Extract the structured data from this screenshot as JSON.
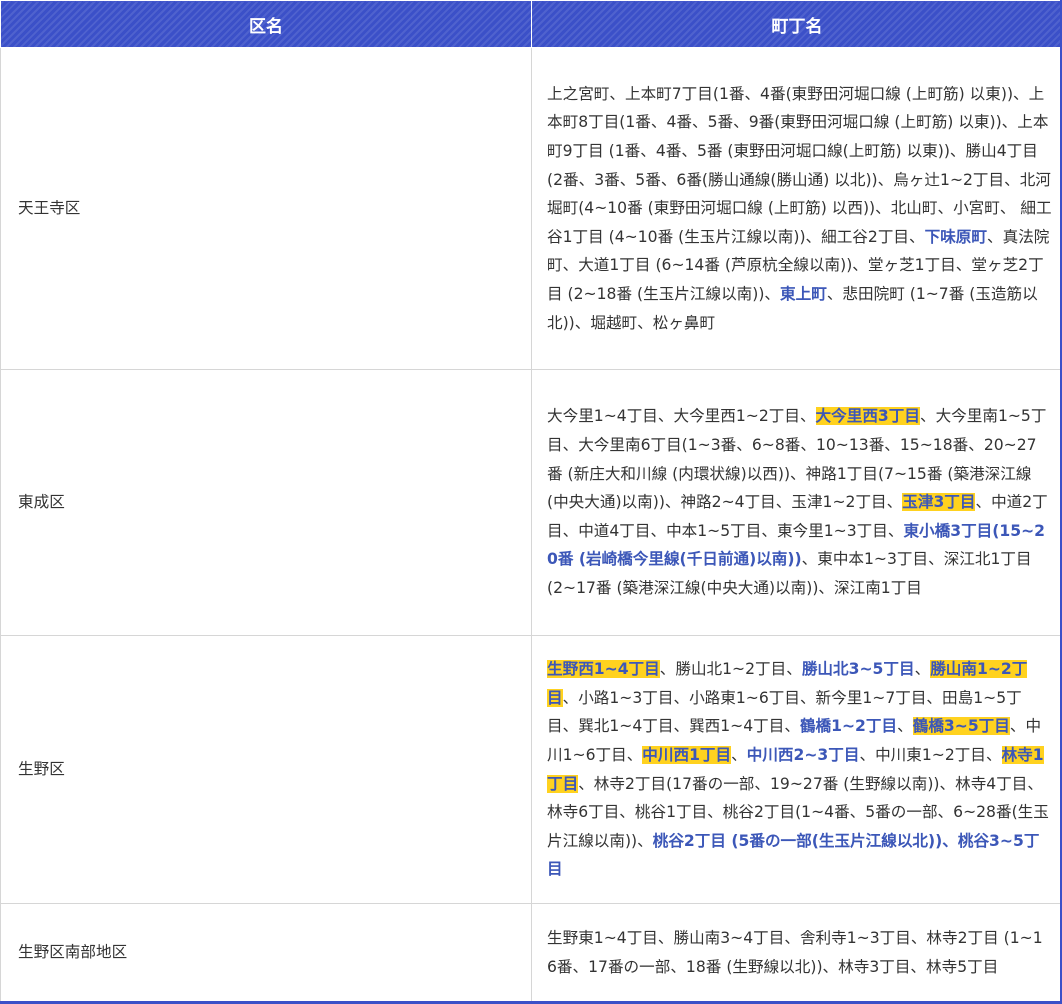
{
  "table": {
    "headers": [
      "区名",
      "町丁名"
    ],
    "rows": [
      {
        "ward": "天王寺区",
        "height": 322,
        "tokens": [
          {
            "t": "上之宮町、上本町7丁目(1番、4番(東野田河堀口線 (上町筋) 以東))、上本町8丁目(1番、4番、5番、9番(東野田河堀口線 (上町筋) 以東))、上本町9丁目 (1番、4番、5番 (東野田河堀口線(上町筋) 以東))、勝山4丁目(2番、3番、5番、6番(勝山通線(勝山通) 以北))、烏ヶ辻1~2丁目、北河堀町(4~10番 (東野田河堀口線 (上町筋) 以西))、北山町、小宮町、 細工谷1丁目 (4~10番 (生玉片江線以南))、細工谷2丁目、"
          },
          {
            "t": "下味原町",
            "s": "b"
          },
          {
            "t": "、真法院町、大道1丁目 (6~14番 (芦原杭全線以南))、堂ヶ芝1丁目、堂ヶ芝2丁目 (2~18番 (生玉片江線以南))、"
          },
          {
            "t": "東上町",
            "s": "b"
          },
          {
            "t": "、悲田院町 (1~7番 (玉造筋以北))、堀越町、松ヶ鼻町"
          }
        ]
      },
      {
        "ward": "東成区",
        "height": 266,
        "tokens": [
          {
            "t": "大今里1~4丁目、大今里西1~2丁目、"
          },
          {
            "t": "大今里西3丁目",
            "s": "bh"
          },
          {
            "t": "、大今里南1~5丁目、大今里南6丁目(1~3番、6~8番、10~13番、15~18番、20~27番 (新庄大和川線 (内環状線)以西))、神路1丁目(7~15番 (築港深江線(中央大通)以南))、神路2~4丁目、玉津1~2丁目、"
          },
          {
            "t": "玉津3丁目",
            "s": "bh"
          },
          {
            "t": "、中道2丁目、中道4丁目、中本1~5丁目、東今里1~3丁目、"
          },
          {
            "t": "東小橋3丁目(15~20番 (岩崎橋今里線(千日前通)以南))",
            "s": "b"
          },
          {
            "t": "、東中本1~3丁目、深江北1丁目 (2~17番 (築港深江線(中央大通)以南))、深江南1丁目"
          }
        ]
      },
      {
        "ward": "生野区",
        "height": 268,
        "tokens": [
          {
            "t": "生野西1~4丁目",
            "s": "bh"
          },
          {
            "t": "、勝山北1~2丁目、"
          },
          {
            "t": "勝山北3~5丁目",
            "s": "b"
          },
          {
            "t": "、"
          },
          {
            "t": "勝山南1~2丁目",
            "s": "bh"
          },
          {
            "t": "、小路1~3丁目、小路東1~6丁目、新今里1~7丁目、田島1~5丁目、巽北1~4丁目、巽西1~4丁目、"
          },
          {
            "t": "鶴橋1~2丁目",
            "s": "b"
          },
          {
            "t": "、"
          },
          {
            "t": "鶴橋3~5丁目",
            "s": "bh"
          },
          {
            "t": "、中川1~6丁目、"
          },
          {
            "t": "中川西1丁目",
            "s": "bh"
          },
          {
            "t": "、"
          },
          {
            "t": "中川西2~3丁目",
            "s": "b"
          },
          {
            "t": "、中川東1~2丁目、"
          },
          {
            "t": "林寺1丁目",
            "s": "bh"
          },
          {
            "t": "、林寺2丁目(17番の一部、19~27番 (生野線以南))、林寺4丁目、林寺6丁目、桃谷1丁目、桃谷2丁目(1~4番、5番の一部、6~28番(生玉片江線以南))、"
          },
          {
            "t": "桃谷2丁目 (5番の一部(生玉片江線以北))、桃谷3~5丁目",
            "s": "b"
          }
        ]
      },
      {
        "ward": "生野区南部地区",
        "height": 98,
        "tokens": [
          {
            "t": "生野東1~4丁目、勝山南3~4丁目、舎利寺1~3丁目、林寺2丁目 (1~16番、17番の一部、18番 (生野線以北))、林寺3丁目、林寺5丁目"
          }
        ]
      }
    ]
  }
}
